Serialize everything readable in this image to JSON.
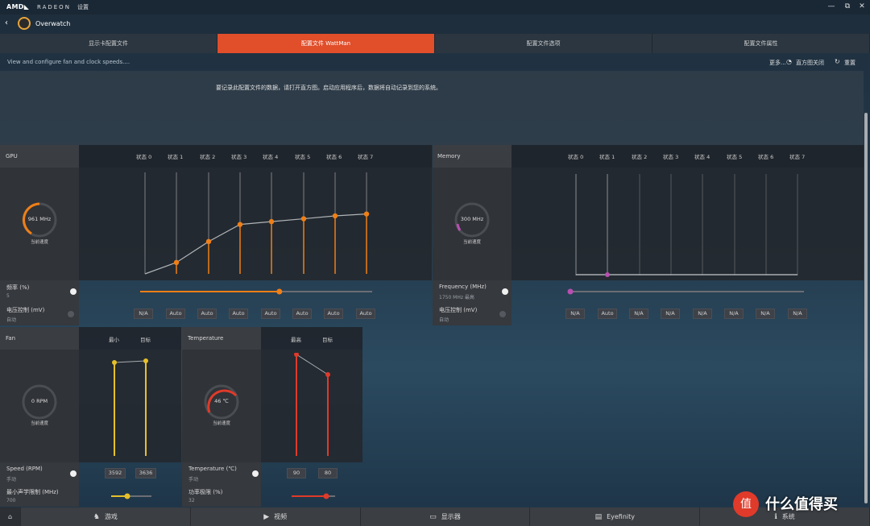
{
  "titlebar": {
    "logo": "AMD◣",
    "radeon": "RADEON",
    "settings": "设置",
    "min": "—",
    "restore": "⧉",
    "close": "✕"
  },
  "nav": {
    "back": "‹",
    "game": "Overwatch"
  },
  "tabs": [
    "显示卡配置文件",
    "配置文件 WattMan",
    "配置文件选项",
    "配置文件属性"
  ],
  "info": {
    "text": "View and configure fan and clock speeds....",
    "more": "更多...",
    "overview_close": "直方图关闭",
    "reset": "重置"
  },
  "notice": "要记录此配置文件的数据，请打开直方图。启动应用程序后，数据将自动记录到您的系统。",
  "gpu": {
    "title": "GPU",
    "states": [
      "状态 0",
      "状态 1",
      "状态 2",
      "状态 3",
      "状态 4",
      "状态 5",
      "状态 6",
      "状态 7"
    ],
    "gauge_value": "961 MHz",
    "gauge_caption": "当前速度",
    "freq_label": "频率 (%)",
    "freq_value": "5",
    "freq_level": 0.6,
    "volt_label": "电压控制 (mV)",
    "volt_value": "自动",
    "volt_boxes": [
      "N/A",
      "Auto",
      "Auto",
      "Auto",
      "Auto",
      "Auto",
      "Auto",
      "Auto"
    ],
    "curve": [
      0.0,
      0.12,
      0.34,
      0.52,
      0.55,
      0.58,
      0.61,
      0.63
    ],
    "accent": "#f07f16"
  },
  "memory": {
    "title": "Memory",
    "states": [
      "状态 0",
      "状态 1",
      "状态 2",
      "状态 3",
      "状态 4",
      "状态 5",
      "状态 6",
      "状态 7"
    ],
    "gauge_value": "300 MHz",
    "gauge_caption": "当前速度",
    "freq_label": "Frequency (MHz)",
    "freq_value": "1750 MHz 最高",
    "volt_label": "电压控制 (mV)",
    "volt_value": "自动",
    "volt_boxes": [
      "N/A",
      "Auto",
      "N/A",
      "N/A",
      "N/A",
      "N/A",
      "N/A",
      "N/A"
    ],
    "accent": "#b84fb0"
  },
  "fan": {
    "title": "Fan",
    "min_label": "最小",
    "target_label": "目标",
    "gauge_value": "0 RPM",
    "gauge_caption": "当前速度",
    "speed_label": "Speed (RPM)",
    "speed_value": "手动",
    "speed_boxes": [
      "3592",
      "3636"
    ],
    "acoustic_label": "最小声学限制 (MHz)",
    "acoustic_value": "700",
    "accent": "#e6c02a"
  },
  "temperature": {
    "title": "Temperature",
    "max_label": "最高",
    "target_label": "目标",
    "gauge_value": "46 ℃",
    "gauge_caption": "当前速度",
    "temp_label": "Temperature (℃)",
    "temp_value": "手动",
    "temp_boxes": [
      "90",
      "80"
    ],
    "power_label": "功率极限 (%)",
    "power_value": "32",
    "accent": "#e03a2a"
  },
  "bottombar": [
    {
      "icon": "⌂",
      "label": ""
    },
    {
      "icon": "♞",
      "label": "游戏"
    },
    {
      "icon": "▶",
      "label": "视频"
    },
    {
      "icon": "▭",
      "label": "显示器"
    },
    {
      "icon": "▤",
      "label": "Eyefinity"
    },
    {
      "icon": "ℹ",
      "label": "系统"
    }
  ],
  "watermark": {
    "badge": "值",
    "text": "什么值得买"
  }
}
